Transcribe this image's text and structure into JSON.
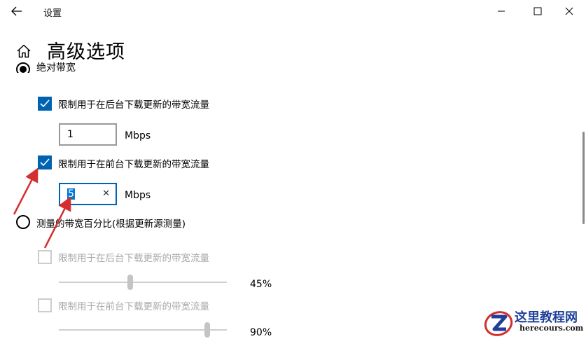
{
  "window": {
    "title": "设置",
    "controls": [
      "minimize-icon",
      "maximize-icon",
      "close-icon"
    ]
  },
  "page": {
    "title": "高级选项"
  },
  "absolute_bandwidth": {
    "label": "绝对带宽",
    "selected": true,
    "background": {
      "label": "限制用于在后台下载更新的带宽流量",
      "checked": true,
      "value": "1",
      "unit": "Mbps"
    },
    "foreground": {
      "label": "限制用于在前台下载更新的带宽流量",
      "checked": true,
      "value": "5",
      "unit": "Mbps"
    }
  },
  "percentage_bandwidth": {
    "label": "测量的带宽百分比(根据更新源测量)",
    "selected": false,
    "background": {
      "label": "限制用于在后台下载更新的带宽流量",
      "checked": false,
      "percent": 45,
      "value_text": "45%"
    },
    "foreground": {
      "label": "限制用于在前台下载更新的带宽流量",
      "checked": false,
      "percent": 90,
      "value_text": "90%"
    }
  },
  "watermark": {
    "name": "这里教程网",
    "domain": "herecours.com"
  },
  "colors": {
    "accent": "#0063b1",
    "annotation": "#d32f2f",
    "disabled": "#a8a8a8"
  }
}
